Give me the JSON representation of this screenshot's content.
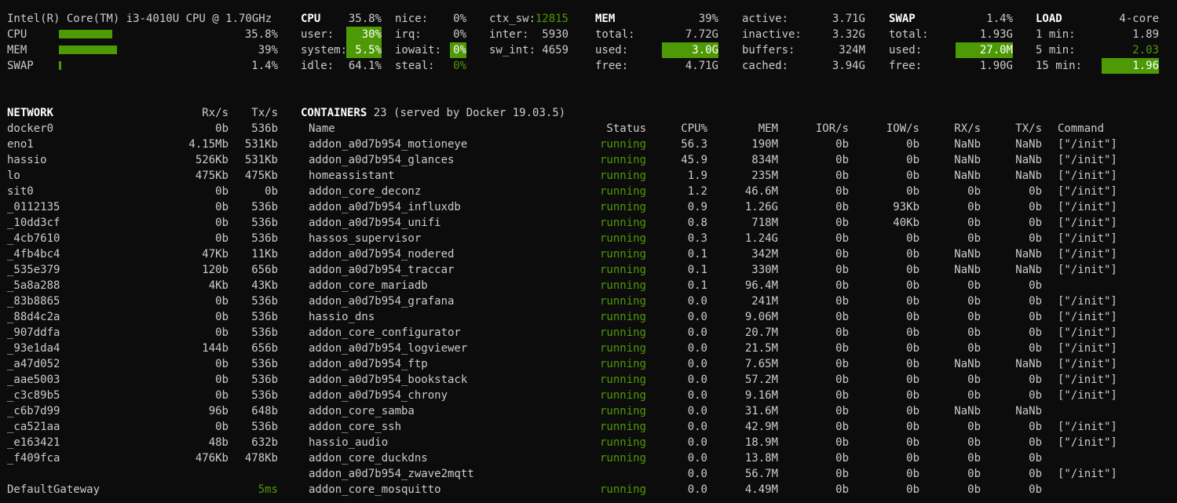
{
  "cpu_model": "Intel(R) Core(TM) i3-4010U CPU @ 1.70GHz",
  "quicklook": {
    "cpu": {
      "label": "CPU",
      "value": "35.8%",
      "fill": 0.358
    },
    "mem": {
      "label": "MEM",
      "value": "39%",
      "fill": 0.39
    },
    "swap": {
      "label": "SWAP",
      "value": "1.4%",
      "fill": 0.014
    }
  },
  "cpu": {
    "title": "CPU",
    "total": "35.8%",
    "user_label": "user:",
    "user": "30%",
    "system_label": "system:",
    "system": "5.5%",
    "idle_label": "idle:",
    "idle": "64.1%",
    "nice_label": "nice:",
    "nice": "0%",
    "irq_label": "irq:",
    "irq": "0%",
    "iowait_label": "iowait:",
    "iowait": "0%",
    "steal_label": "steal:",
    "steal": "0%",
    "ctx_sw_label": "ctx_sw:",
    "ctx_sw": "12815",
    "inter_label": "inter:",
    "inter": "5930",
    "sw_int_label": "sw_int:",
    "sw_int": "4659"
  },
  "mem": {
    "title": "MEM",
    "percent": "39%",
    "total_label": "total:",
    "total": "7.72G",
    "used_label": "used:",
    "used": "3.0G",
    "free_label": "free:",
    "free": "4.71G",
    "active_label": "active:",
    "active": "3.71G",
    "inactive_label": "inactive:",
    "inactive": "3.32G",
    "buffers_label": "buffers:",
    "buffers": "324M",
    "cached_label": "cached:",
    "cached": "3.94G"
  },
  "swap": {
    "title": "SWAP",
    "percent": "1.4%",
    "total_label": "total:",
    "total": "1.93G",
    "used_label": "used:",
    "used": "27.0M",
    "free_label": "free:",
    "free": "1.90G"
  },
  "load": {
    "title": "LOAD",
    "cores": "4-core",
    "min1_label": "1 min:",
    "min1": "1.89",
    "min5_label": "5 min:",
    "min5": "2.03",
    "min15_label": "15 min:",
    "min15": "1.96"
  },
  "network": {
    "title": "NETWORK",
    "rx_header": "Rx/s",
    "tx_header": "Tx/s",
    "rows": [
      {
        "name": "docker0",
        "rx": "0b",
        "tx": "536b"
      },
      {
        "name": "eno1",
        "rx": "4.15Mb",
        "tx": "531Kb"
      },
      {
        "name": "hassio",
        "rx": "526Kb",
        "tx": "531Kb"
      },
      {
        "name": "lo",
        "rx": "475Kb",
        "tx": "475Kb"
      },
      {
        "name": "sit0",
        "rx": "0b",
        "tx": "0b"
      },
      {
        "name": "_0112135",
        "rx": "0b",
        "tx": "536b"
      },
      {
        "name": "_10dd3cf",
        "rx": "0b",
        "tx": "536b"
      },
      {
        "name": "_4cb7610",
        "rx": "0b",
        "tx": "536b"
      },
      {
        "name": "_4fb4bc4",
        "rx": "47Kb",
        "tx": "11Kb"
      },
      {
        "name": "_535e379",
        "rx": "120b",
        "tx": "656b"
      },
      {
        "name": "_5a8a288",
        "rx": "4Kb",
        "tx": "43Kb"
      },
      {
        "name": "_83b8865",
        "rx": "0b",
        "tx": "536b"
      },
      {
        "name": "_88d4c2a",
        "rx": "0b",
        "tx": "536b"
      },
      {
        "name": "_907ddfa",
        "rx": "0b",
        "tx": "536b"
      },
      {
        "name": "_93e1da4",
        "rx": "144b",
        "tx": "656b"
      },
      {
        "name": "_a47d052",
        "rx": "0b",
        "tx": "536b"
      },
      {
        "name": "_aae5003",
        "rx": "0b",
        "tx": "536b"
      },
      {
        "name": "_c3c89b5",
        "rx": "0b",
        "tx": "536b"
      },
      {
        "name": "_c6b7d99",
        "rx": "96b",
        "tx": "648b"
      },
      {
        "name": "_ca521aa",
        "rx": "0b",
        "tx": "536b"
      },
      {
        "name": "_e163421",
        "rx": "48b",
        "tx": "632b"
      },
      {
        "name": "_f409fca",
        "rx": "476Kb",
        "tx": "478Kb"
      }
    ],
    "gateway_label": "DefaultGateway",
    "gateway_value": "5ms"
  },
  "containers": {
    "title": "CONTAINERS",
    "count": "23",
    "served": "(served by Docker 19.03.5)",
    "headers": {
      "name": "Name",
      "status": "Status",
      "cpu": "CPU%",
      "mem": "MEM",
      "ior": "IOR/s",
      "iow": "IOW/s",
      "rx": "RX/s",
      "tx": "TX/s",
      "command": "Command"
    },
    "rows": [
      {
        "name": "addon_a0d7b954_motioneye",
        "status": "running",
        "cpu": "56.3",
        "mem": "190M",
        "ior": "0b",
        "iow": "0b",
        "rx": "NaNb",
        "tx": "NaNb",
        "command": "[\"/init\"]"
      },
      {
        "name": "addon_a0d7b954_glances",
        "status": "running",
        "cpu": "45.9",
        "mem": "834M",
        "ior": "0b",
        "iow": "0b",
        "rx": "NaNb",
        "tx": "NaNb",
        "command": "[\"/init\"]"
      },
      {
        "name": "homeassistant",
        "status": "running",
        "cpu": "1.9",
        "mem": "235M",
        "ior": "0b",
        "iow": "0b",
        "rx": "NaNb",
        "tx": "NaNb",
        "command": "[\"/init\"]"
      },
      {
        "name": "addon_core_deconz",
        "status": "running",
        "cpu": "1.2",
        "mem": "46.6M",
        "ior": "0b",
        "iow": "0b",
        "rx": "0b",
        "tx": "0b",
        "command": "[\"/init\"]"
      },
      {
        "name": "addon_a0d7b954_influxdb",
        "status": "running",
        "cpu": "0.9",
        "mem": "1.26G",
        "ior": "0b",
        "iow": "93Kb",
        "rx": "0b",
        "tx": "0b",
        "command": "[\"/init\"]"
      },
      {
        "name": "addon_a0d7b954_unifi",
        "status": "running",
        "cpu": "0.8",
        "mem": "718M",
        "ior": "0b",
        "iow": "40Kb",
        "rx": "0b",
        "tx": "0b",
        "command": "[\"/init\"]"
      },
      {
        "name": "hassos_supervisor",
        "status": "running",
        "cpu": "0.3",
        "mem": "1.24G",
        "ior": "0b",
        "iow": "0b",
        "rx": "0b",
        "tx": "0b",
        "command": "[\"/init\"]"
      },
      {
        "name": "addon_a0d7b954_nodered",
        "status": "running",
        "cpu": "0.1",
        "mem": "342M",
        "ior": "0b",
        "iow": "0b",
        "rx": "NaNb",
        "tx": "NaNb",
        "command": "[\"/init\"]"
      },
      {
        "name": "addon_a0d7b954_traccar",
        "status": "running",
        "cpu": "0.1",
        "mem": "330M",
        "ior": "0b",
        "iow": "0b",
        "rx": "NaNb",
        "tx": "NaNb",
        "command": "[\"/init\"]"
      },
      {
        "name": "addon_core_mariadb",
        "status": "running",
        "cpu": "0.1",
        "mem": "96.4M",
        "ior": "0b",
        "iow": "0b",
        "rx": "0b",
        "tx": "0b",
        "command": ""
      },
      {
        "name": "addon_a0d7b954_grafana",
        "status": "running",
        "cpu": "0.0",
        "mem": "241M",
        "ior": "0b",
        "iow": "0b",
        "rx": "0b",
        "tx": "0b",
        "command": "[\"/init\"]"
      },
      {
        "name": "hassio_dns",
        "status": "running",
        "cpu": "0.0",
        "mem": "9.06M",
        "ior": "0b",
        "iow": "0b",
        "rx": "0b",
        "tx": "0b",
        "command": "[\"/init\"]"
      },
      {
        "name": "addon_core_configurator",
        "status": "running",
        "cpu": "0.0",
        "mem": "20.7M",
        "ior": "0b",
        "iow": "0b",
        "rx": "0b",
        "tx": "0b",
        "command": "[\"/init\"]"
      },
      {
        "name": "addon_a0d7b954_logviewer",
        "status": "running",
        "cpu": "0.0",
        "mem": "21.5M",
        "ior": "0b",
        "iow": "0b",
        "rx": "0b",
        "tx": "0b",
        "command": "[\"/init\"]"
      },
      {
        "name": "addon_a0d7b954_ftp",
        "status": "running",
        "cpu": "0.0",
        "mem": "7.65M",
        "ior": "0b",
        "iow": "0b",
        "rx": "NaNb",
        "tx": "NaNb",
        "command": "[\"/init\"]"
      },
      {
        "name": "addon_a0d7b954_bookstack",
        "status": "running",
        "cpu": "0.0",
        "mem": "57.2M",
        "ior": "0b",
        "iow": "0b",
        "rx": "0b",
        "tx": "0b",
        "command": "[\"/init\"]"
      },
      {
        "name": "addon_a0d7b954_chrony",
        "status": "running",
        "cpu": "0.0",
        "mem": "9.16M",
        "ior": "0b",
        "iow": "0b",
        "rx": "0b",
        "tx": "0b",
        "command": "[\"/init\"]"
      },
      {
        "name": "addon_core_samba",
        "status": "running",
        "cpu": "0.0",
        "mem": "31.6M",
        "ior": "0b",
        "iow": "0b",
        "rx": "NaNb",
        "tx": "NaNb",
        "command": ""
      },
      {
        "name": "addon_core_ssh",
        "status": "running",
        "cpu": "0.0",
        "mem": "42.9M",
        "ior": "0b",
        "iow": "0b",
        "rx": "0b",
        "tx": "0b",
        "command": "[\"/init\"]"
      },
      {
        "name": "hassio_audio",
        "status": "running",
        "cpu": "0.0",
        "mem": "18.9M",
        "ior": "0b",
        "iow": "0b",
        "rx": "0b",
        "tx": "0b",
        "command": "[\"/init\"]"
      },
      {
        "name": "addon_core_duckdns",
        "status": "running",
        "cpu": "0.0",
        "mem": "13.8M",
        "ior": "0b",
        "iow": "0b",
        "rx": "0b",
        "tx": "0b",
        "command": ""
      },
      {
        "name": "addon_a0d7b954_zwave2mqtt",
        "status": "",
        "cpu": "0.0",
        "mem": "56.7M",
        "ior": "0b",
        "iow": "0b",
        "rx": "0b",
        "tx": "0b",
        "command": "[\"/init\"]"
      },
      {
        "name": "addon_core_mosquitto",
        "status": "running",
        "cpu": "0.0",
        "mem": "4.49M",
        "ior": "0b",
        "iow": "0b",
        "rx": "0b",
        "tx": "0b",
        "command": ""
      }
    ]
  },
  "colors": {
    "background": "#0c0c0c",
    "text": "#cccccc",
    "accent_green": "#4e9a06",
    "title": "#ffffff"
  }
}
